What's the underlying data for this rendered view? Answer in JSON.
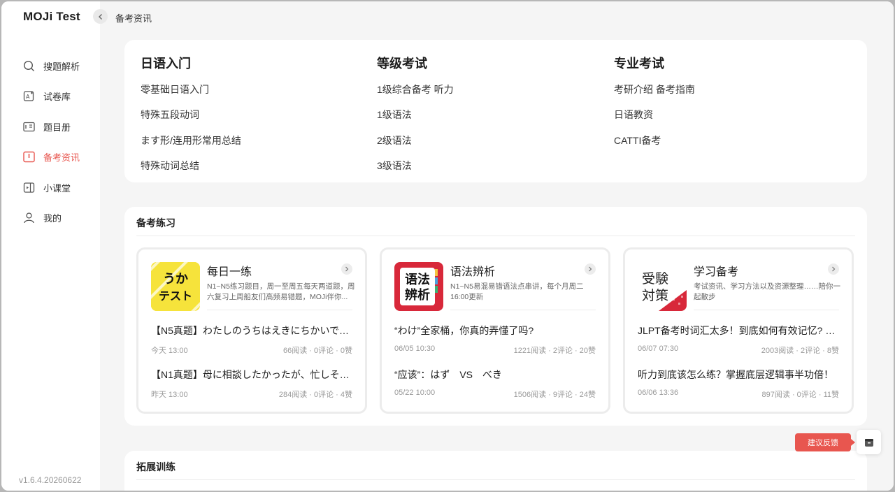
{
  "app": {
    "title": "MOJi Test",
    "version": "v1.6.4.20260622"
  },
  "sidebar": {
    "items": [
      {
        "label": "搜题解析",
        "icon": "search-icon"
      },
      {
        "label": "试卷库",
        "icon": "exam-icon"
      },
      {
        "label": "题目册",
        "icon": "book-icon"
      },
      {
        "label": "备考资讯",
        "icon": "news-icon",
        "active": true
      },
      {
        "label": "小课堂",
        "icon": "video-icon"
      },
      {
        "label": "我的",
        "icon": "user-icon"
      }
    ],
    "active_color": "#e8564f"
  },
  "breadcrumb": {
    "title": "备考资讯"
  },
  "categories": [
    {
      "title": "日语入门",
      "links": [
        "零基础日语入门",
        "特殊五段动词",
        "ます形/连用形常用总结",
        "特殊动词总结"
      ]
    },
    {
      "title": "等级考试",
      "links": [
        "1级综合备考 听力",
        "1级语法",
        "2级语法",
        "3级语法"
      ]
    },
    {
      "title": "专业考试",
      "links": [
        "考研介绍 备考指南",
        "日语教资",
        "CATTI备考"
      ]
    }
  ],
  "practice": {
    "title": "备考练习",
    "columns": [
      {
        "name": "每日一练",
        "thumb_text": "うかテスト",
        "desc": "N1~N5练习题目，周一至周五每天两道题，周六复习上周船友们高频易错题，MOJi伴你...",
        "articles": [
          {
            "title": "【N5真题】わたしのうちはえきにちかいで…",
            "time": "今天 13:00",
            "stats": "66阅读 · 0评论 · 0赞"
          },
          {
            "title": "【N1真题】母に相談したかったが、忙しそ…",
            "time": "昨天 13:00",
            "stats": "284阅读 · 0评论 · 4赞"
          }
        ]
      },
      {
        "name": "语法辨析",
        "thumb_text": "语法辨析",
        "desc": "N1~N5易混易错语法点串讲，每个月周二16:00更新",
        "articles": [
          {
            "title": "“わけ”全家桶，你真的弄懂了吗?",
            "time": "06/05 10:30",
            "stats": "1221阅读 · 2评论 · 20赞"
          },
          {
            "title": "“应该”：はず　VS　べき",
            "time": "05/22 10:00",
            "stats": "1506阅读 · 9评论 · 24赞"
          }
        ]
      },
      {
        "name": "学习备考",
        "thumb_text": "受験対策",
        "desc": "考试资讯、学习方法以及资源整理……陪你一起散步",
        "articles": [
          {
            "title": "JLPT备考时词汇太多！到底如何有效记忆? …",
            "time": "06/07 07:30",
            "stats": "2003阅读 · 2评论 · 8赞"
          },
          {
            "title": "听力到底该怎么练？掌握底层逻辑事半功倍！",
            "time": "06/06 13:36",
            "stats": "897阅读 · 0评论 · 11赞"
          }
        ]
      }
    ]
  },
  "extension": {
    "title": "拓展训练"
  },
  "feedback": {
    "label": "建议反馈"
  }
}
